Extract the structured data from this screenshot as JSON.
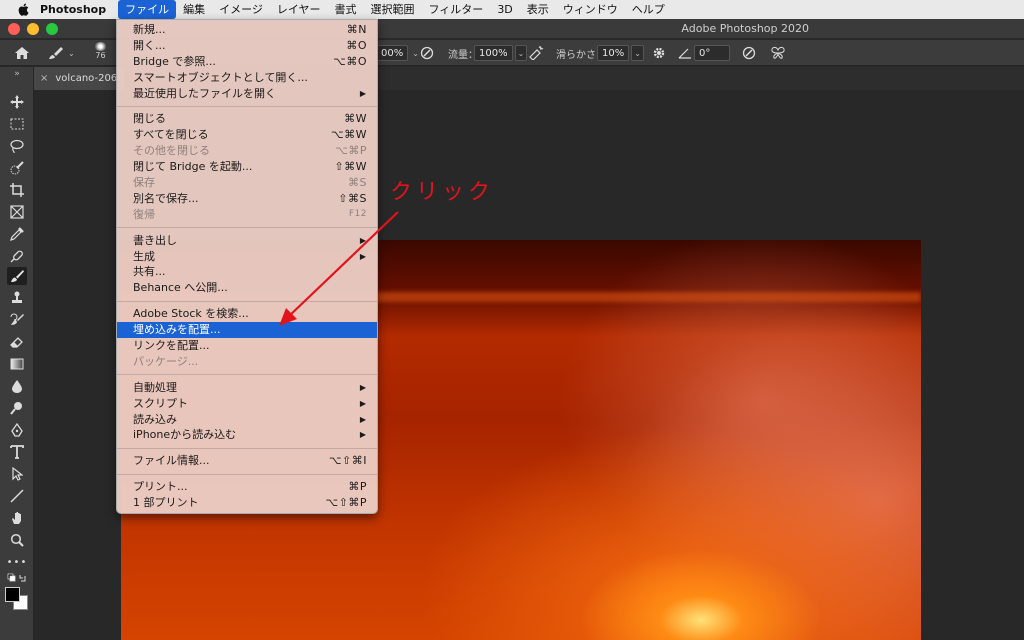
{
  "menubar": {
    "app_name": "Photoshop",
    "items": [
      "ファイル",
      "編集",
      "イメージ",
      "レイヤー",
      "書式",
      "選択範囲",
      "フィルター",
      "3D",
      "表示",
      "ウィンドウ",
      "ヘルプ"
    ]
  },
  "window": {
    "title": "Adobe Photoshop 2020"
  },
  "options": {
    "brush_size": "76",
    "opacity_value": "00%",
    "flow_label": "流量：",
    "flow_value": "100%",
    "smoothing_label": "滑らかさ：",
    "smoothing_value": "10%",
    "angle_value": "0°"
  },
  "document": {
    "tab_name": "volcano-206"
  },
  "file_menu": {
    "items": [
      {
        "label": "新規...",
        "shortcut": "⌘N"
      },
      {
        "label": "開く...",
        "shortcut": "⌘O"
      },
      {
        "label": "Bridge で参照...",
        "shortcut": "⌥⌘O"
      },
      {
        "label": "スマートオブジェクトとして開く...",
        "shortcut": ""
      },
      {
        "label": "最近使用したファイルを開く",
        "submenu": true
      },
      {
        "label": "閉じる",
        "shortcut": "⌘W"
      },
      {
        "label": "すべてを閉じる",
        "shortcut": "⌥⌘W"
      },
      {
        "label": "その他を閉じる",
        "shortcut": "⌥⌘P",
        "disabled": true
      },
      {
        "label": "閉じて Bridge を起動...",
        "shortcut": "⇧⌘W"
      },
      {
        "label": "保存",
        "shortcut": "⌘S",
        "disabled": true
      },
      {
        "label": "別名で保存...",
        "shortcut": "⇧⌘S"
      },
      {
        "label": "復帰",
        "shortcut": "F12",
        "disabled": true
      },
      {
        "label": "書き出し",
        "submenu": true
      },
      {
        "label": "生成",
        "submenu": true
      },
      {
        "label": "共有...",
        "shortcut": ""
      },
      {
        "label": "Behance へ公開...",
        "shortcut": ""
      },
      {
        "label": "Adobe Stock を検索...",
        "shortcut": ""
      },
      {
        "label": "埋め込みを配置...",
        "shortcut": "",
        "highlighted": true
      },
      {
        "label": "リンクを配置...",
        "shortcut": ""
      },
      {
        "label": "パッケージ...",
        "shortcut": "",
        "disabled": true
      },
      {
        "label": "自動処理",
        "submenu": true
      },
      {
        "label": "スクリプト",
        "submenu": true
      },
      {
        "label": "読み込み",
        "submenu": true
      },
      {
        "label": "iPhoneから読み込む",
        "submenu": true
      },
      {
        "label": "ファイル情報...",
        "shortcut": "⌥⇧⌘I"
      },
      {
        "label": "プリント...",
        "shortcut": "⌘P"
      },
      {
        "label": "1 部プリント",
        "shortcut": "⌥⇧⌘P"
      }
    ]
  },
  "annotation": {
    "text": "クリック",
    "color": "#e1141b"
  },
  "colors": {
    "menu_highlight": "#1b63d5",
    "menu_bg": "#ebcdc4",
    "annotation": "#e1141b"
  }
}
